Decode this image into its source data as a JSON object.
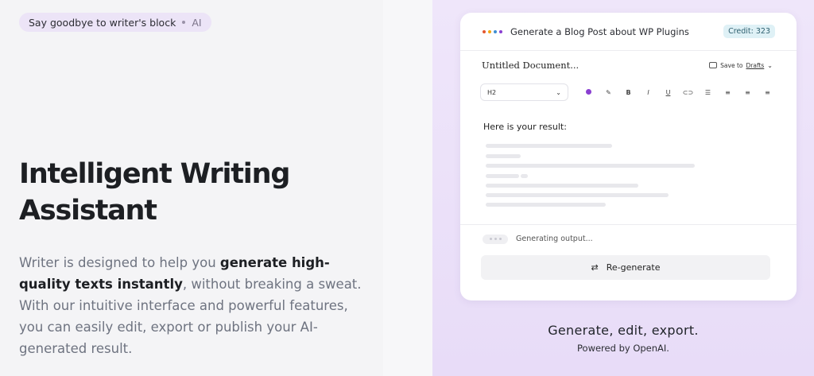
{
  "pill": {
    "text": "Say goodbye to writer's block",
    "tag": "AI"
  },
  "headline": {
    "line1": "Intelligent Writing",
    "line2": "Assistant"
  },
  "description": {
    "part1": "Writer is designed to help you ",
    "bold": "generate high-quality texts instantly",
    "part2": ", without breaking a sweat. With our intuitive interface and powerful features, you can easily edit, export or publish your AI-generated result."
  },
  "card": {
    "title": "Generate a Blog Post about WP Plugins",
    "credit": "Credit: 323",
    "doc_title": "Untitled Document...",
    "save_prefix": "Save to ",
    "save_target": "Drafts",
    "heading_select": "H2",
    "toolbar": [
      "B",
      "I",
      "U"
    ],
    "result_label": "Here is your result:",
    "generating": "Generating output...",
    "regenerate": "Re-generate"
  },
  "footer": {
    "tagline": "Generate, edit, export.",
    "powered": "Powered by OpenAI."
  },
  "colors": {
    "accent": "#8a3fd1",
    "credit_bg": "#dff1f6",
    "pill_bg": "#ece4f7"
  },
  "icons": [
    "four-dots-logo-icon",
    "folder-icon",
    "chevron-down-icon",
    "color-dot-icon",
    "pen-icon",
    "link-icon",
    "list-icon",
    "align-left-icon",
    "align-center-icon",
    "align-right-icon",
    "swap-arrows-icon"
  ]
}
